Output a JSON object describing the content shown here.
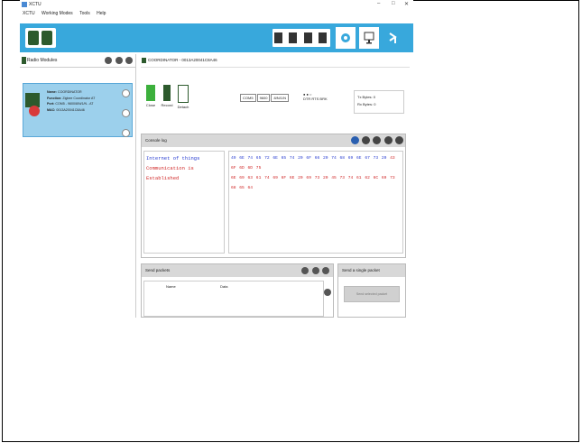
{
  "window": {
    "title": "XCTU",
    "minimize": "–",
    "maximize": "□",
    "close": "✕"
  },
  "menu": [
    "XCTU",
    "Working Modes",
    "Tools",
    "Help"
  ],
  "toolbar": {
    "left_icons": [
      "discover-radio-icon",
      "add-radio-icon"
    ],
    "tool_icons": [
      "xbee-tools-icon",
      "frames-generator-icon",
      "recovery-icon",
      "help-icon"
    ],
    "right_icons": [
      "configuration-mode-icon",
      "console-mode-icon",
      "network-mode-icon"
    ],
    "colors": {
      "bar": "#38a8dc"
    }
  },
  "radio_modules": {
    "header": "Radio Modules",
    "device": {
      "name_label": "Name:",
      "name": "COORDINATOR",
      "function_label": "Function:",
      "function": "Zigbee Coordinator AT",
      "port_label": "Port:",
      "port": "COM5 - 9600/8/N/1/N - AT",
      "mac_label": "MAC:",
      "mac": "0013A20041C8A46"
    }
  },
  "console": {
    "tab_title": "COORDINATOR - 0013A20041C8A46",
    "buttons": [
      "Close",
      "Record",
      "Detach"
    ],
    "serial_settings": [
      "COM5",
      "9600",
      "8/N/1/N"
    ],
    "signals": [
      "DTR",
      "RTS",
      "BRK"
    ],
    "tx_label": "Tx Bytes:",
    "tx_value": "0",
    "rx_label": "Rx Bytes:",
    "rx_value": "0",
    "log_title": "Console log",
    "ascii_text_blue": "Internet of things ",
    "ascii_text_red": "Communication is Established",
    "hex_line1_blue": "49 6E 74 65 72 6E 65 74 20 6F 66 20 74 68 69 6E 67 73 20",
    "hex_line1_red": "43 6F 6D 6D 75",
    "hex_line2_red": "6E 69 63 61 74 69 6F 6E 20 69 73 20 45 73 74 61 62 6C 69 73 68 65 64"
  },
  "send_packets": {
    "title": "Send packets",
    "col_name": "Name",
    "col_data": "Data"
  },
  "send_single": {
    "title": "Send a single packet",
    "button": "Send selected packet"
  }
}
